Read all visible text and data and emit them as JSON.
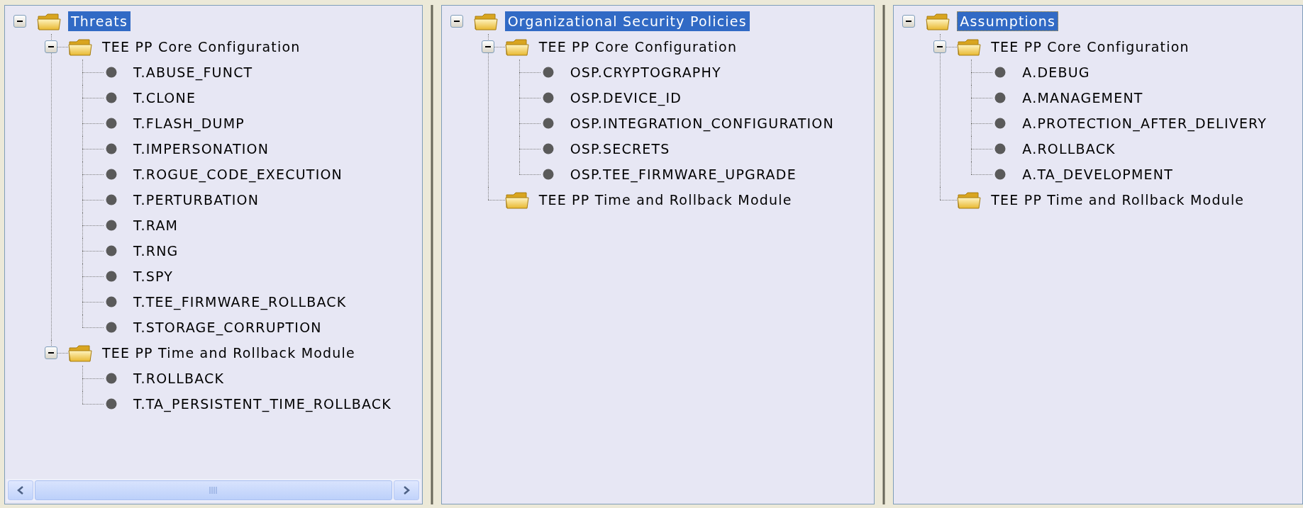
{
  "panels": [
    {
      "horizontal_scrollbar": true,
      "root": {
        "label": "Threats",
        "kind": "folder",
        "expanded": true,
        "selected": true,
        "focused": false,
        "children": [
          {
            "label": "TEE PP Core Configuration",
            "kind": "folder",
            "expanded": true,
            "selected": false,
            "children": [
              {
                "label": "T.ABUSE_FUNCT",
                "kind": "item",
                "selected": false
              },
              {
                "label": "T.CLONE",
                "kind": "item",
                "selected": false
              },
              {
                "label": "T.FLASH_DUMP",
                "kind": "item",
                "selected": false
              },
              {
                "label": "T.IMPERSONATION",
                "kind": "item",
                "selected": false
              },
              {
                "label": "T.ROGUE_CODE_EXECUTION",
                "kind": "item",
                "selected": false
              },
              {
                "label": "T.PERTURBATION",
                "kind": "item",
                "selected": false
              },
              {
                "label": "T.RAM",
                "kind": "item",
                "selected": false
              },
              {
                "label": "T.RNG",
                "kind": "item",
                "selected": false
              },
              {
                "label": "T.SPY",
                "kind": "item",
                "selected": false
              },
              {
                "label": "T.TEE_FIRMWARE_ROLLBACK",
                "kind": "item",
                "selected": false
              },
              {
                "label": "T.STORAGE_CORRUPTION",
                "kind": "item",
                "selected": false
              }
            ]
          },
          {
            "label": "TEE PP Time and Rollback Module",
            "kind": "folder",
            "expanded": true,
            "selected": false,
            "children": [
              {
                "label": "T.ROLLBACK",
                "kind": "item",
                "selected": false
              },
              {
                "label": "T.TA_PERSISTENT_TIME_ROLLBACK",
                "kind": "item",
                "selected": false
              }
            ]
          }
        ]
      }
    },
    {
      "root": {
        "label": "Organizational Security Policies",
        "kind": "folder",
        "expanded": true,
        "selected": true,
        "focused": false,
        "children": [
          {
            "label": "TEE PP Core Configuration",
            "kind": "folder",
            "expanded": true,
            "selected": false,
            "children": [
              {
                "label": "OSP.CRYPTOGRAPHY",
                "kind": "item",
                "selected": false
              },
              {
                "label": "OSP.DEVICE_ID",
                "kind": "item",
                "selected": false
              },
              {
                "label": "OSP.INTEGRATION_CONFIGURATION",
                "kind": "item",
                "selected": false
              },
              {
                "label": "OSP.SECRETS",
                "kind": "item",
                "selected": false
              },
              {
                "label": "OSP.TEE_FIRMWARE_UPGRADE",
                "kind": "item",
                "selected": false
              }
            ]
          },
          {
            "label": "TEE PP Time and Rollback Module",
            "kind": "folder",
            "selected": false
          }
        ]
      }
    },
    {
      "root": {
        "label": "Assumptions",
        "kind": "folder",
        "expanded": true,
        "selected": true,
        "focused": true,
        "children": [
          {
            "label": "TEE PP Core Configuration",
            "kind": "folder",
            "expanded": true,
            "selected": false,
            "children": [
              {
                "label": "A.DEBUG",
                "kind": "item",
                "selected": false
              },
              {
                "label": "A.MANAGEMENT",
                "kind": "item",
                "selected": false
              },
              {
                "label": "A.PROTECTION_AFTER_DELIVERY",
                "kind": "item",
                "selected": false
              },
              {
                "label": "A.ROLLBACK",
                "kind": "item",
                "selected": false
              },
              {
                "label": "A.TA_DEVELOPMENT",
                "kind": "item",
                "selected": false
              }
            ]
          },
          {
            "label": "TEE PP Time and Rollback Module",
            "kind": "folder",
            "selected": false
          }
        ]
      }
    }
  ]
}
